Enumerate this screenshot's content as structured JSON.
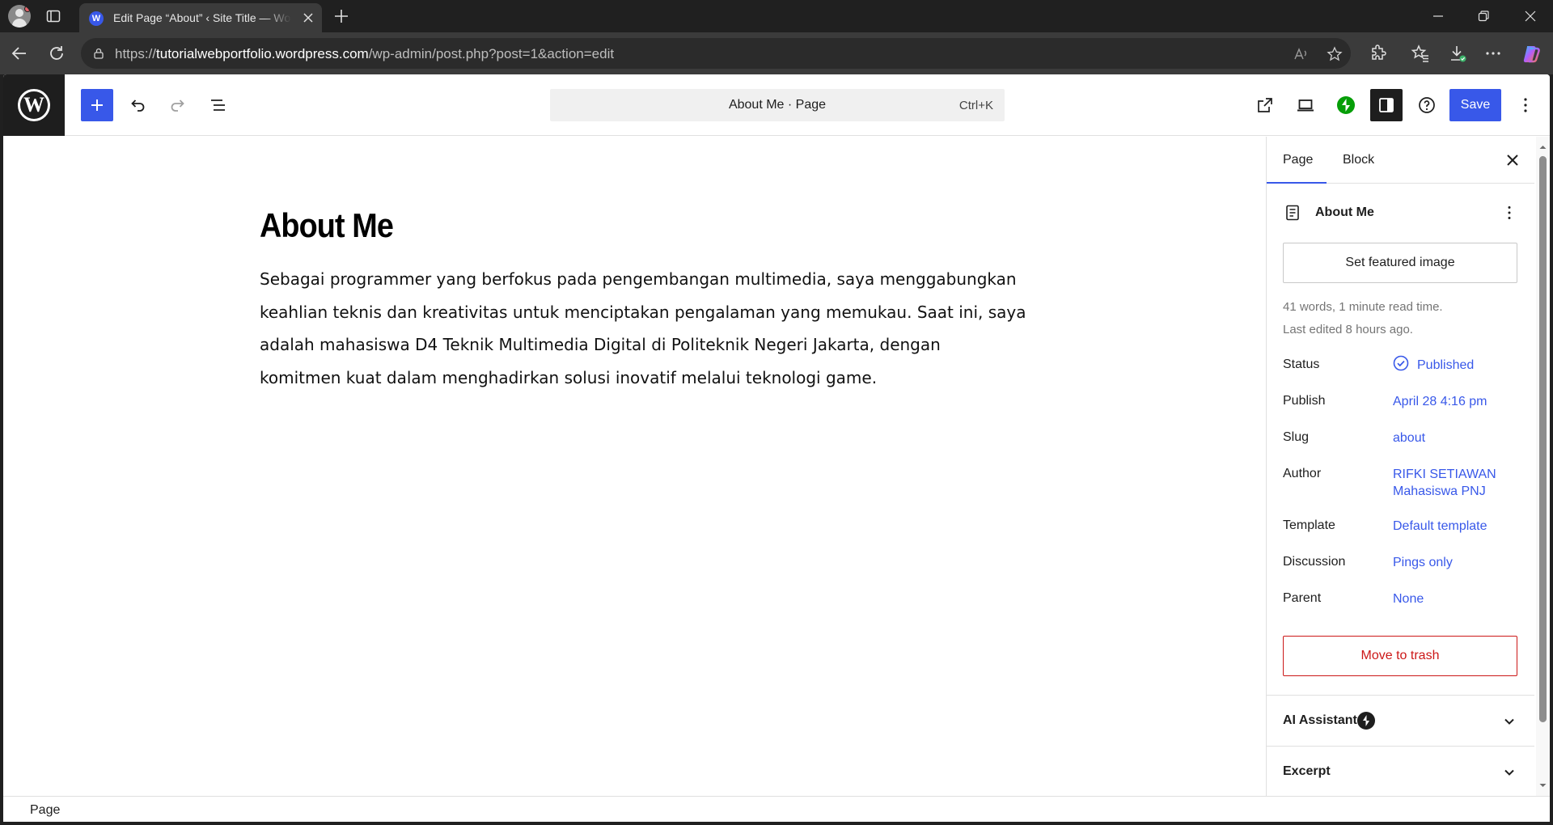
{
  "browser": {
    "tab_title": "Edit Page “About” ‹ Site Title — WordPress.com",
    "url_prefix": "https://",
    "url_host": "tutorialwebportfolio.wordpress.com",
    "url_path": "/wp-admin/post.php?post=1&action=edit"
  },
  "editor": {
    "doc_title": "About Me · Page",
    "shortcut": "Ctrl+K",
    "save_label": "Save"
  },
  "post": {
    "title": "About Me",
    "body_lines": [
      "Sebagai programmer yang berfokus pada pengembangan multimedia, saya menggabungkan",
      "keahlian teknis dan kreativitas untuk menciptakan pengalaman yang memukau. Saat ini, saya",
      "adalah mahasiswa D4 Teknik Multimedia Digital di Politeknik Negeri Jakarta, dengan",
      "komitmen kuat dalam menghadirkan solusi inovatif melalui teknologi game."
    ]
  },
  "sidebar": {
    "tab_page": "Page",
    "tab_block": "Block",
    "doc_title": "About Me",
    "featured_image": "Set featured image",
    "meta_words": "41 words, 1 minute read time.",
    "meta_edited": "Last edited 8 hours ago.",
    "rows": {
      "status": {
        "label": "Status",
        "value": "Published"
      },
      "publish": {
        "label": "Publish",
        "value": "April 28 4:16 pm"
      },
      "slug": {
        "label": "Slug",
        "value": "about"
      },
      "author": {
        "label": "Author",
        "value_line1": "RIFKI SETIAWAN",
        "value_line2": "Mahasiswa PNJ"
      },
      "template": {
        "label": "Template",
        "value": "Default template"
      },
      "discussion": {
        "label": "Discussion",
        "value": "Pings only"
      },
      "parent": {
        "label": "Parent",
        "value": "None"
      }
    },
    "trash": "Move to trash",
    "panel_ai": "AI Assistant",
    "panel_excerpt": "Excerpt"
  },
  "footer": {
    "breadcrumb": "Page"
  },
  "colors": {
    "accent": "#3858e9",
    "danger": "#cc1818",
    "jetpack_green": "#069e08"
  }
}
